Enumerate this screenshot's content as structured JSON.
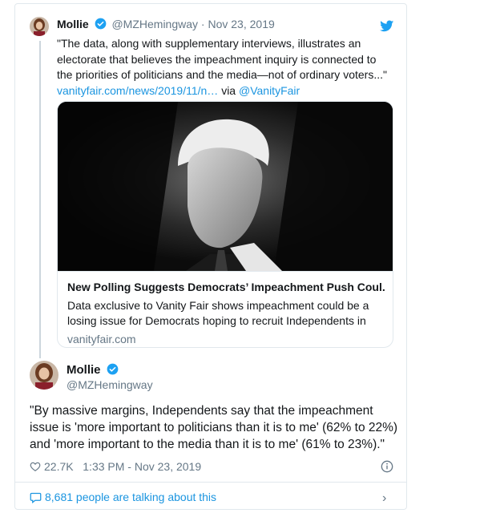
{
  "quoted_tweet": {
    "name": "Mollie",
    "handle": "@MZHemingway",
    "separator": "·",
    "date": "Nov 23, 2019",
    "text": "\"The data, along with supplementary interviews, illustrates an electorate that believes the impeachment inquiry is connected to the priorities of politicians and the media—not of ordinary voters...\"",
    "link_text": "vanityfair.com/news/2019/11/n…",
    "via_text": "via",
    "via_handle": "@VanityFair",
    "link_card": {
      "title": "New Polling Suggests Democrats’ Impeachment Push Coul...",
      "description": "Data exclusive to Vanity Fair shows impeachment could be a losing issue for Democrats hoping to recruit Independents in",
      "domain": "vanityfair.com"
    }
  },
  "main_tweet": {
    "name": "Mollie",
    "handle": "@MZHemingway",
    "text": "\"By massive margins, Independents say that the impeachment issue is 'more important to politicians than it is to me' (62% to 22%) and 'more important to the media than it is to me' (61% to 23%).\"",
    "likes": "22.7K",
    "timestamp": "1:33 PM - Nov 23, 2019"
  },
  "footer": {
    "talking_text": "8,681 people are talking about this"
  },
  "icons": [
    "verified-badge-icon",
    "twitter-bird-icon",
    "heart-icon",
    "info-icon",
    "speech-bubble-icon",
    "chevron-right-icon"
  ],
  "colors": {
    "link": "#1b95e0",
    "muted": "#657786",
    "border": "#e1e8ed",
    "text": "#14171a"
  }
}
